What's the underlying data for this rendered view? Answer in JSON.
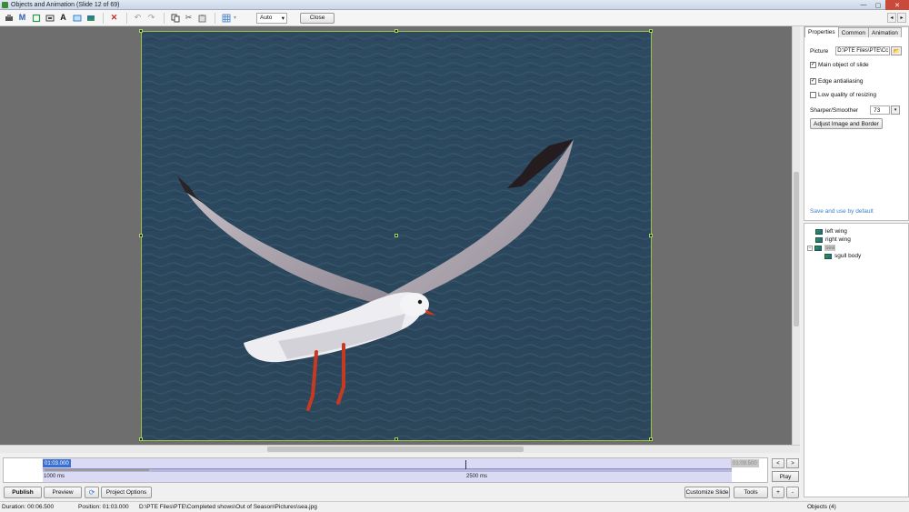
{
  "window": {
    "title": "Objects and Animation  (Slide 12 of 69)"
  },
  "toolbar": {
    "zoom_value": "Auto",
    "close_label": "Close",
    "icons": [
      "add-object-icon",
      "mask-icon",
      "frame-icon",
      "image-icon",
      "text-icon",
      "rectangle-icon",
      "picture-icon",
      "delete-icon",
      "undo-icon",
      "redo-icon",
      "copy-icon",
      "cut-icon",
      "paste-icon",
      "grid-icon"
    ],
    "text_icon_glyph": "A",
    "mask_icon_glyph": "M"
  },
  "tabs": [
    "Properties",
    "Common",
    "Animation"
  ],
  "properties": {
    "picture_label": "Picture",
    "picture_value": "D:\\PTE Files\\PTE\\Cc",
    "main_object_label": "Main object of slide",
    "main_object_checked": true,
    "edge_antialiasing_label": "Edge antialiasing",
    "edge_antialiasing_checked": true,
    "low_quality_label": "Low quality of resizing",
    "low_quality_checked": false,
    "sharper_label": "Sharper/Smoother",
    "sharper_value": "73",
    "adjust_button": "Adjust Image and Border",
    "save_default_link": "Save and use by default"
  },
  "objects_tree": [
    {
      "label": "left wing",
      "level": 1
    },
    {
      "label": "right wing",
      "level": 1
    },
    {
      "label": "sea",
      "level": 0,
      "expanded": true
    },
    {
      "label": "sgull body",
      "level": 2
    }
  ],
  "timeline": {
    "current_time": "01:03.000",
    "end_time": "01:09.500",
    "label_start": "1000 ms",
    "label_mid": "2500 ms",
    "play_label": "Play",
    "prev_label": "<",
    "next_label": ">"
  },
  "buttons": {
    "publish": "Publish",
    "preview": "Preview",
    "project_options": "Project Options",
    "customize_slide": "Customize Slide",
    "tools": "Tools",
    "plus": "+",
    "minus": "-"
  },
  "status": {
    "duration": "Duration:  00:06.500",
    "position": "Position:  01:03.000",
    "path": "D:\\PTE Files\\PTE\\Completed shows\\Out of Season\\Pictures\\sea.jpg",
    "objects": "Objects (4)"
  },
  "colors": {
    "sea": "#2e4a60",
    "selection_frame": "#9fc04a",
    "timeline_track": "#dadaf4",
    "link": "#3a7fc8"
  }
}
